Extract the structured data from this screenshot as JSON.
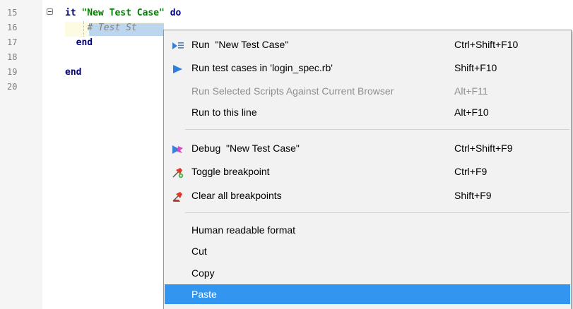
{
  "editor": {
    "line_numbers": [
      "15",
      "16",
      "17",
      "18",
      "19",
      "20"
    ],
    "lines": [
      {
        "kw": "it",
        "str": "\"New Test Case\"",
        "kw2": "do"
      },
      {
        "comment": "# Test St"
      },
      {
        "kw": "end"
      },
      {},
      {
        "kw": "end"
      },
      {}
    ]
  },
  "context_menu": {
    "items": [
      {
        "label": "Run  \"New Test Case\"",
        "shortcut": "Ctrl+Shift+F10",
        "icon": "run-test-case-icon"
      },
      {
        "label": "Run test cases in 'login_spec.rb'",
        "shortcut": "Shift+F10",
        "icon": "play-icon"
      },
      {
        "label": "Run Selected Scripts Against Current Browser",
        "shortcut": "Alt+F11",
        "disabled": true
      },
      {
        "label": "Run to this line",
        "shortcut": "Alt+F10"
      },
      {
        "label": "Debug  \"New Test Case\"",
        "shortcut": "Ctrl+Shift+F9",
        "icon": "debug-icon"
      },
      {
        "label": "Toggle breakpoint",
        "shortcut": "Ctrl+F9",
        "icon": "toggle-breakpoint-icon"
      },
      {
        "label": "Clear all breakpoints",
        "shortcut": "Shift+F9",
        "icon": "clear-breakpoints-icon"
      },
      {
        "label": "Human readable format",
        "shortcut": ""
      },
      {
        "label": "Cut",
        "shortcut": ""
      },
      {
        "label": "Copy",
        "shortcut": ""
      },
      {
        "label": "Paste",
        "shortcut": "",
        "highlighted": true
      }
    ]
  },
  "colors": {
    "keyword": "#000080",
    "string": "#008000",
    "comment": "#808080",
    "selection": "#bcd6ee",
    "menu_highlight": "#3296f0",
    "disabled_text": "#8e8e8e"
  }
}
